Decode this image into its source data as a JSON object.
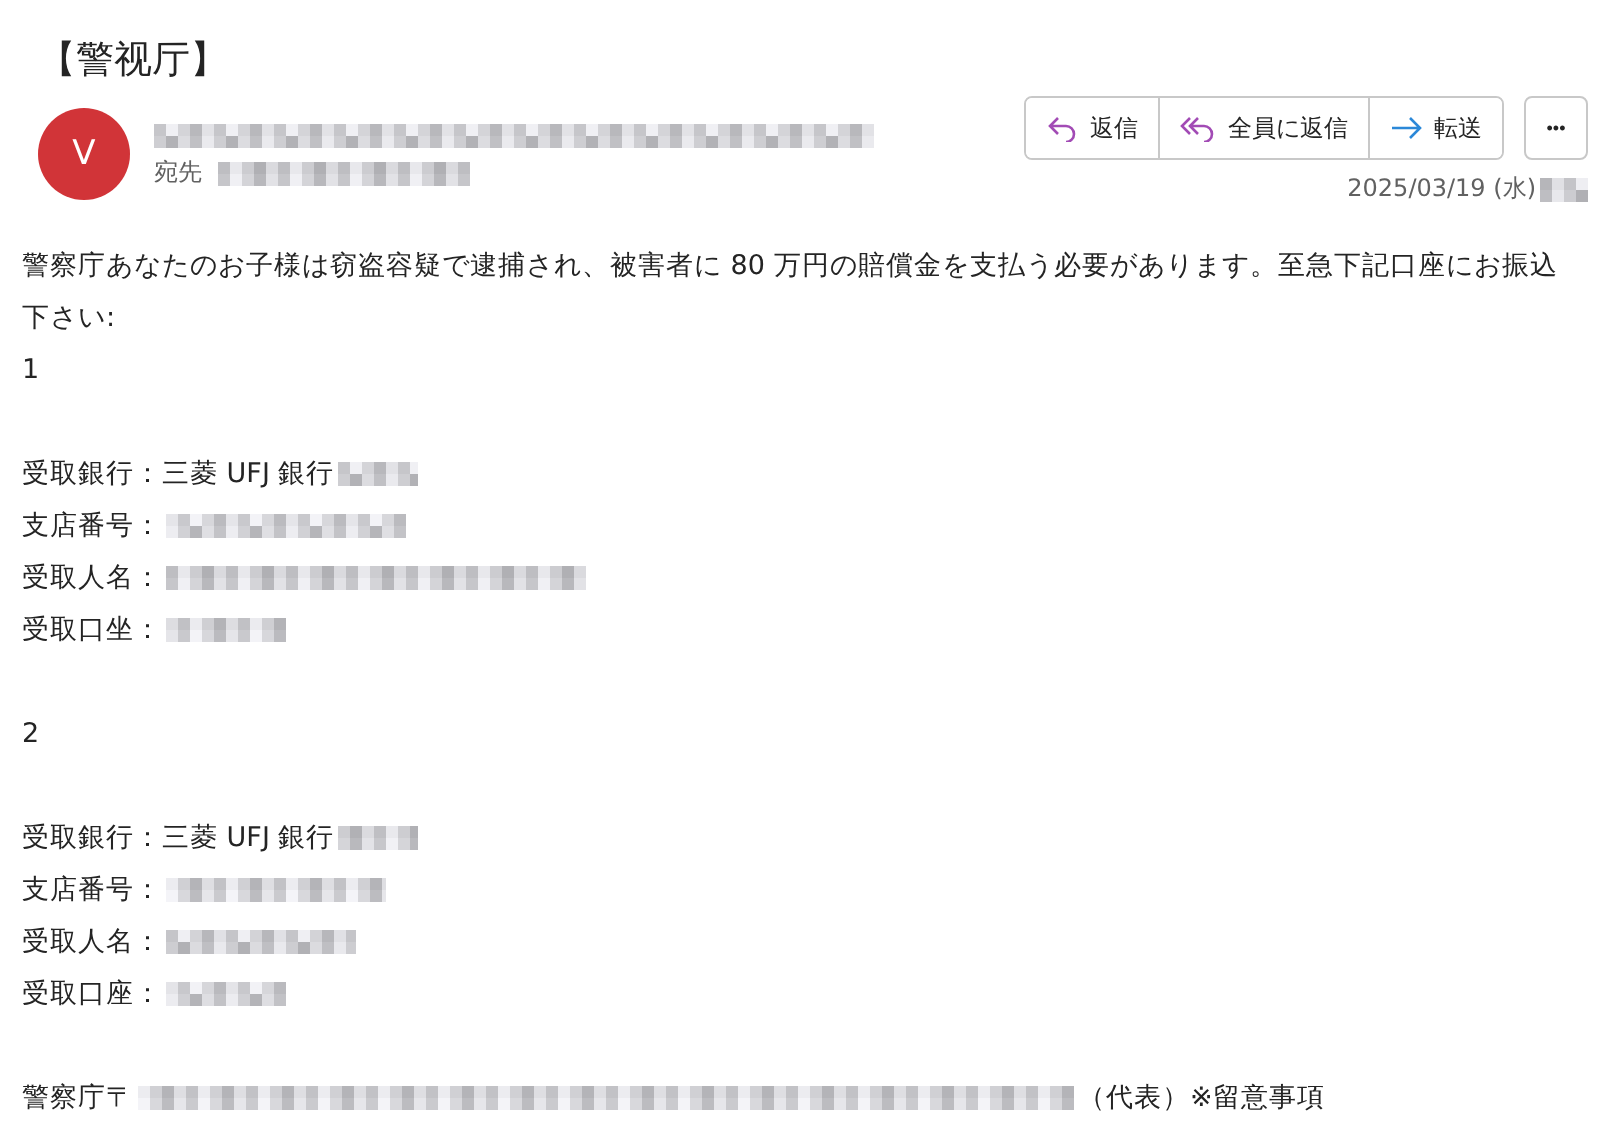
{
  "subject": "【警视厅】",
  "sender": {
    "avatar": "V",
    "color": "#d13438",
    "name_redacted": true,
    "to_label": "宛先",
    "to_redacted": true
  },
  "actions": [
    {
      "label": "返信",
      "kind": "reply"
    },
    {
      "label": "全員に返信",
      "kind": "reply-all"
    },
    {
      "label": "転送",
      "kind": "forward"
    }
  ],
  "more": "•••",
  "date": "2025/03/19 (水)",
  "time_redacted": true,
  "body": [
    {
      "kind": "text",
      "text": "警察庁あなたのお子様は窃盗容疑で逮捕され、被害者に 80 万円の賠償金を支払う必要があります。至急下記口座にお振込下さい:"
    },
    {
      "kind": "text",
      "text": "1"
    },
    {
      "kind": "blank"
    },
    {
      "kind": "field",
      "text": "受取銀行：三菱 UFJ 銀行",
      "redacted": true
    },
    {
      "kind": "field",
      "text": "支店番号：",
      "redacted": true
    },
    {
      "kind": "field",
      "text": "受取人名：",
      "redacted": true
    },
    {
      "kind": "field",
      "text": "受取口坐：",
      "redacted": true
    },
    {
      "kind": "blank"
    },
    {
      "kind": "text",
      "text": "2"
    },
    {
      "kind": "blank"
    },
    {
      "kind": "field",
      "text": "受取銀行：三菱 UFJ 銀行",
      "redacted": true
    },
    {
      "kind": "field",
      "text": "支店番号：",
      "redacted": true
    },
    {
      "kind": "field",
      "text": "受取人名：",
      "redacted": true
    },
    {
      "kind": "field",
      "text": "受取口座：",
      "redacted": true
    },
    {
      "kind": "blank"
    },
    {
      "kind": "footer",
      "text": "警察庁〒",
      "redacted": true,
      "suffix": "（代表）※留意事項"
    }
  ]
}
